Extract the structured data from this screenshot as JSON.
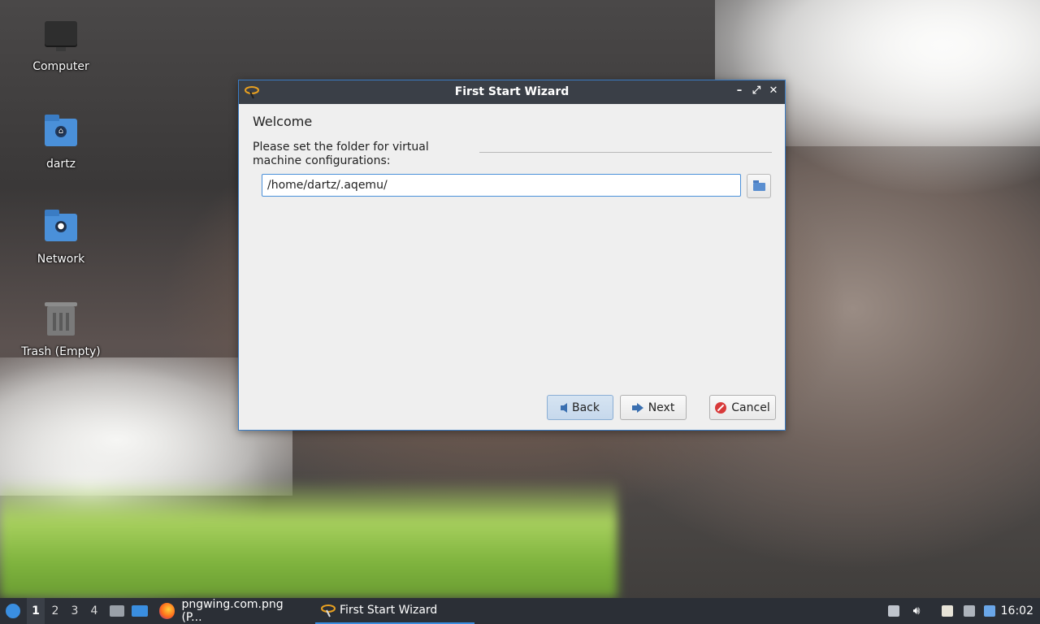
{
  "desktop": {
    "icons": [
      {
        "label": "Computer",
        "icon": "computer-icon"
      },
      {
        "label": "dartz",
        "icon": "home-folder-icon"
      },
      {
        "label": "Network",
        "icon": "network-folder-icon"
      },
      {
        "label": "Trash (Empty)",
        "icon": "trash-icon"
      }
    ]
  },
  "window": {
    "title": "First Start Wizard",
    "page_title": "Welcome",
    "section_label": "Please set the folder for virtual machine configurations:",
    "folder_path": "/home/dartz/.aqemu/",
    "buttons": {
      "back": "Back",
      "next": "Next",
      "cancel": "Cancel"
    }
  },
  "taskbar": {
    "workspaces": [
      "1",
      "2",
      "3",
      "4"
    ],
    "active_workspace": "1",
    "tasks": [
      {
        "label": "pngwing.com.png (P...",
        "icon": "firefox-icon"
      },
      {
        "label": "First Start Wizard",
        "icon": "aqemu-icon"
      }
    ],
    "clock": "16:02"
  },
  "colors": {
    "accent": "#3a7cc4",
    "titlebar": "#3a3f47",
    "taskbar": "#2b2f36"
  }
}
